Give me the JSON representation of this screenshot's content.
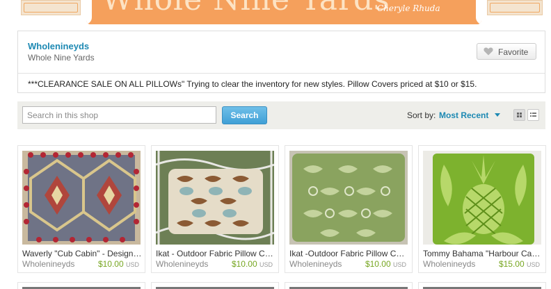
{
  "banner": {
    "title": "Whole Nine Yards",
    "subtitle": "Cheryle Rhuda"
  },
  "shop": {
    "name": "Wholenineyds",
    "title": "Whole Nine Yards",
    "favorite_label": "Favorite",
    "favorite_icon": "heart-icon",
    "announcement": "***CLEARANCE SALE ON ALL PILLOWs\" Trying to clear the inventory for new styles. Pillow Covers priced at $10 or $15."
  },
  "search": {
    "placeholder": "Search in this shop",
    "button_label": "Search",
    "sort_label": "Sort by:",
    "sort_value": "Most Recent",
    "view_icons": [
      "grid-view-icon",
      "list-view-icon"
    ]
  },
  "listings": [
    {
      "title": "Waverly \"Cub Cabin\" - Designer Pillow Cover",
      "shop": "Wholenineyds",
      "price": "$10.00",
      "currency": "USD"
    },
    {
      "title": "Ikat - Outdoor Fabric Pillow Cover",
      "shop": "Wholenineyds",
      "price": "$10.00",
      "currency": "USD"
    },
    {
      "title": "Ikat -Outdoor Fabric Pillow Cover",
      "shop": "Wholenineyds",
      "price": "$10.00",
      "currency": "USD"
    },
    {
      "title": "Tommy Bahama \"Harbour Cay\" Pillow Cover",
      "shop": "Wholenineyds",
      "price": "$15.00",
      "currency": "USD"
    }
  ],
  "colors": {
    "brand_orange": "#f5a05c",
    "link_blue": "#1d89b3",
    "price_green": "#76a620"
  }
}
